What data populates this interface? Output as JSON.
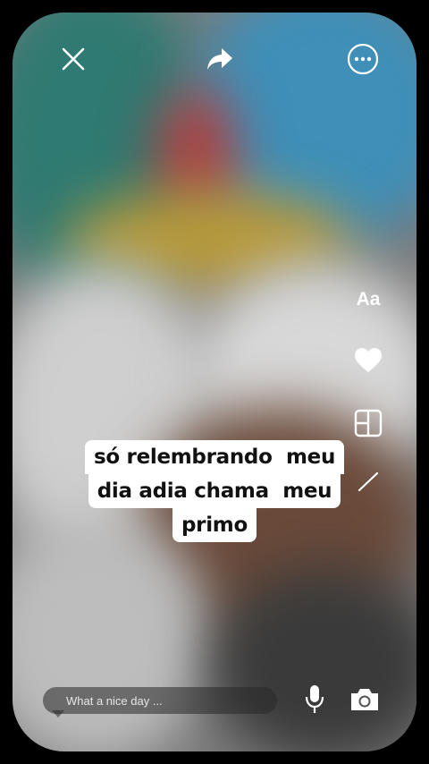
{
  "topbar": {
    "close_icon": "close-icon",
    "share_icon": "share-arrow-icon",
    "more_icon": "more-options-icon"
  },
  "side_tools": {
    "text_tool_label": "Aa",
    "heart_icon": "heart-icon",
    "layout_icon": "layout-grid-icon",
    "draw_icon": "pen-stroke-icon"
  },
  "caption": {
    "lines": [
      "só relembrando  meu",
      "dia adia chama  meu",
      "primo"
    ]
  },
  "bottom_bar": {
    "input_placeholder": "What a nice day ...",
    "mic_icon": "microphone-icon",
    "camera_icon": "camera-icon"
  },
  "colors": {
    "caption_bg": "#ffffff",
    "caption_text": "#111111",
    "icon": "#ffffff"
  }
}
